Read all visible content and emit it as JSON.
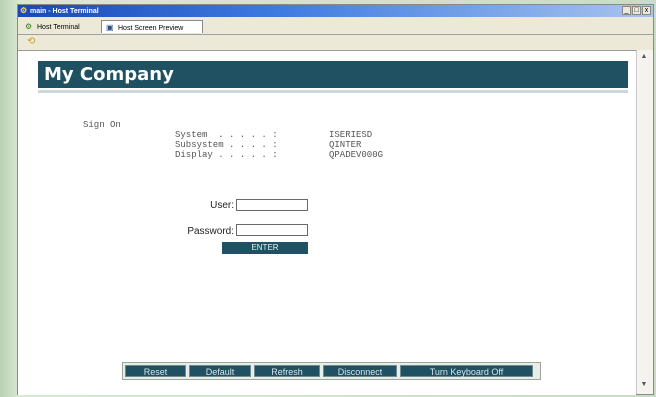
{
  "window": {
    "title": "main - Host Terminal",
    "controls": [
      "_",
      "□",
      "x"
    ]
  },
  "tabs": [
    {
      "label": "Host Terminal",
      "icon": "terminal-icon"
    },
    {
      "label": "Host Screen Preview",
      "icon": "preview-icon"
    }
  ],
  "banner": {
    "title": "My Company"
  },
  "signon": {
    "heading": "Sign On",
    "rows": [
      {
        "label": "System  . . . . . :",
        "value": "ISERIESD"
      },
      {
        "label": "Subsystem . . . . :",
        "value": "QINTER"
      },
      {
        "label": "Display . . . . . :",
        "value": "QPADEV000G"
      }
    ]
  },
  "form": {
    "user_label": "User:",
    "user_value": "",
    "password_label": "Password:",
    "password_value": "",
    "enter_label": "ENTER"
  },
  "function_keys": [
    "Reset",
    "Default",
    "Refresh",
    "Disconnect",
    "Turn Keyboard Off"
  ],
  "colors": {
    "accent": "#1f5163",
    "titlebar": "#1a48b8"
  }
}
